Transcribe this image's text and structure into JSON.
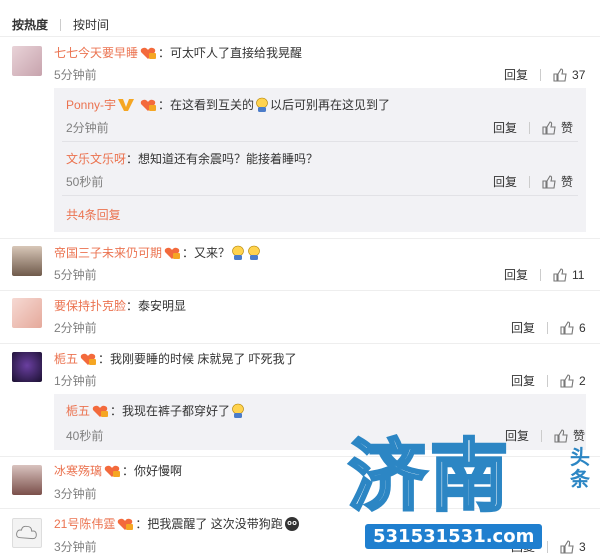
{
  "sort": {
    "hot": "按热度",
    "time": "按时间"
  },
  "labels": {
    "reply": "回复",
    "like": "赞"
  },
  "comments": [
    {
      "name": "七七今天要早睡",
      "text": "：可太吓人了直接给我晃醒",
      "time": "5分钟前",
      "likes": "37",
      "replies": [
        {
          "name": "Ponny-宇",
          "text": "：在这看到互关的",
          "text2": "以后可别再在这见到了",
          "time": "2分钟前"
        },
        {
          "name": "文乐文乐呀",
          "text": "：想知道还有余震吗？能接着睡吗？",
          "time": "50秒前"
        }
      ],
      "more": "共4条回复"
    },
    {
      "name": "帝国三子未来仍可期",
      "text": "：又来？",
      "time": "5分钟前",
      "likes": "11"
    },
    {
      "name": "要保持扑克脸",
      "text": "：泰安明显",
      "time": "2分钟前",
      "likes": "6"
    },
    {
      "name": "栀五",
      "text": "：我刚要睡的时候 床就晃了 吓死我了",
      "time": "1分钟前",
      "likes": "2",
      "replies": [
        {
          "name": "栀五",
          "text": "：我现在裤子都穿好了",
          "time": "40秒前"
        }
      ]
    },
    {
      "name": "冰寒殇璃",
      "text": "：你好慢啊",
      "time": "3分钟前",
      "likes": ""
    },
    {
      "name": "21号陈伟霆",
      "text": "：把我震醒了 这次没带狗跑",
      "time": "3分钟前",
      "likes": "3"
    }
  ],
  "watermark": {
    "brand": "济南",
    "sub": "头条",
    "phone": "531531531.com"
  },
  "colors": {
    "name": "#eb7350",
    "reply_bg": "#f2f2f5",
    "brand_blue": "#2c86c4"
  }
}
